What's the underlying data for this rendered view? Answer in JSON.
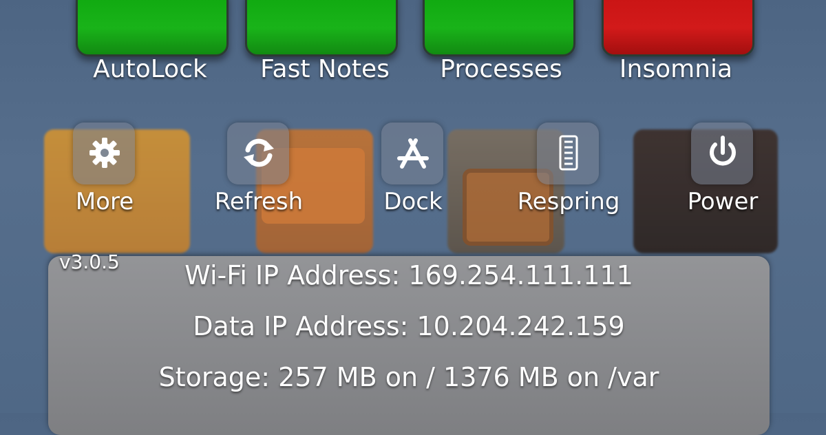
{
  "toggles": [
    {
      "label": "AutoLock",
      "state": "on",
      "icon": "autolock-toggle-icon"
    },
    {
      "label": "Fast Notes",
      "state": "on",
      "icon": "fast-notes-toggle-icon"
    },
    {
      "label": "Processes",
      "state": "on",
      "icon": "processes-toggle-icon"
    },
    {
      "label": "Insomnia",
      "state": "off",
      "icon": "insomnia-toggle-icon"
    }
  ],
  "actions": [
    {
      "label": "More",
      "icon": "gear-icon"
    },
    {
      "label": "Refresh",
      "icon": "refresh-icon"
    },
    {
      "label": "Dock",
      "icon": "app-store-icon"
    },
    {
      "label": "Respring",
      "icon": "respring-icon"
    },
    {
      "label": "Power",
      "icon": "power-icon"
    }
  ],
  "version": "v3.0.5",
  "info": {
    "wifi": "Wi-Fi IP Address: 169.254.111.111",
    "data": "Data IP Address: 10.204.242.159",
    "storage": "Storage: 257 MB on / 1376 MB on /var"
  },
  "colors": {
    "toggle_on": "#14ad14",
    "toggle_off": "#cc1616",
    "background": "#526a88",
    "panel": "#8c8c8e"
  }
}
